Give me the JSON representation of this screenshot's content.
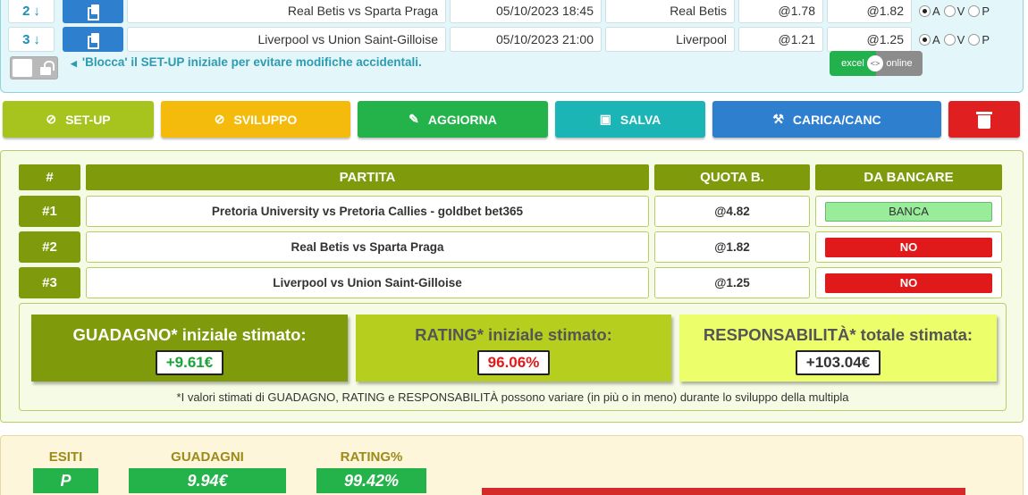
{
  "setup": {
    "rows": [
      {
        "num": "2",
        "match": "Real Betis vs Sparta Praga",
        "datetime": "05/10/2023 18:45",
        "team": "Real Betis",
        "quota1": "@1.78",
        "quota2": "@1.82"
      },
      {
        "num": "3",
        "match": "Liverpool vs Union Saint-Gilloise",
        "datetime": "05/10/2023 21:00",
        "team": "Liverpool",
        "quota1": "@1.21",
        "quota2": "@1.25"
      }
    ],
    "radio_labels": [
      "A",
      "V",
      "P"
    ],
    "lock_note": "'Blocca' il SET-UP iniziale per evitare modifiche accidentali.",
    "switch_left": "excel",
    "switch_right": "online"
  },
  "actions": {
    "setup": "SET-UP",
    "sviluppo": "SVILUPPO",
    "aggiorna": "AGGIORNA",
    "salva": "SALVA",
    "carica": "CARICA/CANC"
  },
  "results": {
    "headers": {
      "hash": "#",
      "partita": "PARTITA",
      "quota": "QUOTA B.",
      "bancare": "DA BANCARE"
    },
    "rows": [
      {
        "num": "#1",
        "partita": "Pretoria University vs Pretoria Callies - goldbet bet365",
        "quota": "@4.82",
        "status": "BANCA"
      },
      {
        "num": "#2",
        "partita": "Real Betis vs Sparta Praga",
        "quota": "@1.82",
        "status": "NO"
      },
      {
        "num": "#3",
        "partita": "Liverpool vs Union Saint-Gilloise",
        "quota": "@1.25",
        "status": "NO"
      }
    ],
    "guadagno_label": "GUADAGNO* iniziale stimato:",
    "guadagno_value": "+9.61€",
    "rating_label": "RATING* iniziale stimato:",
    "rating_value": "96.06%",
    "resp_label": "RESPONSABILITÀ* totale stimata:",
    "resp_value": "+103.04€",
    "note": "*I valori stimati di GUADAGNO, RATING e RESPONSABILITÀ possono variare (in più o in meno) durante lo sviluppo della multipla"
  },
  "bottom": {
    "esiti_label": "ESITI",
    "esiti_value": "P",
    "guadagni_label": "GUADAGNI",
    "guadagni_value": "9.94€",
    "rating_label": "RATING%",
    "rating_value": "99.42%"
  },
  "colors": {
    "olive": "#7f9a0a",
    "green": "#24b34b",
    "red": "#e01a1a",
    "blue": "#2f7fcf",
    "yellow": "#f5bb0c",
    "teal": "#1bb5b5"
  }
}
